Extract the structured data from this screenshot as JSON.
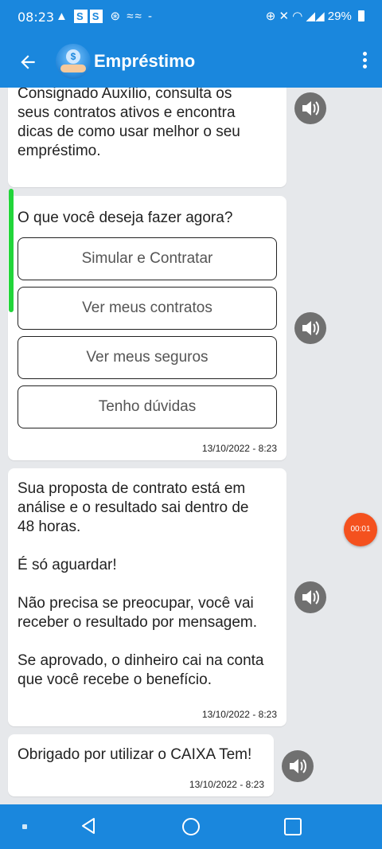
{
  "status_bar": {
    "time": "08:23",
    "battery": "29%",
    "left_icons": [
      "warning-icon",
      "s-app-icon",
      "s-app-icon",
      "sync-icon",
      "cast-icon",
      "cast-icon",
      "dash-icon"
    ],
    "right_icons": [
      "alarm-icon",
      "mute-icon",
      "wifi-icon",
      "signal-icon",
      "signal-icon",
      "battery-icon"
    ]
  },
  "app_bar": {
    "title": "Empréstimo",
    "color": "#1a87dd"
  },
  "messages": {
    "m1": {
      "text": "Consignado Auxílio, consulta os\nseus contratos ativos e encontra\ndicas de como usar melhor o seu\nempréstimo."
    },
    "m2": {
      "question": "O que você deseja fazer agora?",
      "options": [
        "Simular e Contratar",
        "Ver meus contratos",
        "Ver meus seguros",
        "Tenho dúvidas"
      ],
      "timestamp": "13/10/2022 - 8:23"
    },
    "m3": {
      "text": "Sua proposta de contrato está em\nanálise e o resultado sai dentro de\n48 horas.\n\nÉ só aguardar!\n\nNão precisa se preocupar, você vai\nreceber o resultado por mensagem.\n\nSe aprovado, o dinheiro cai na conta\nque você recebe o benefício.",
      "timestamp": "13/10/2022 - 8:23"
    },
    "m4": {
      "text": "Obrigado por utilizar o CAIXA Tem!",
      "timestamp": "13/10/2022 - 8:23"
    }
  },
  "timer": {
    "label": "00:01",
    "color": "#f4511e"
  },
  "nav_bar": {
    "icons": [
      "nav-back-icon",
      "nav-home-icon",
      "nav-recent-icon"
    ]
  }
}
